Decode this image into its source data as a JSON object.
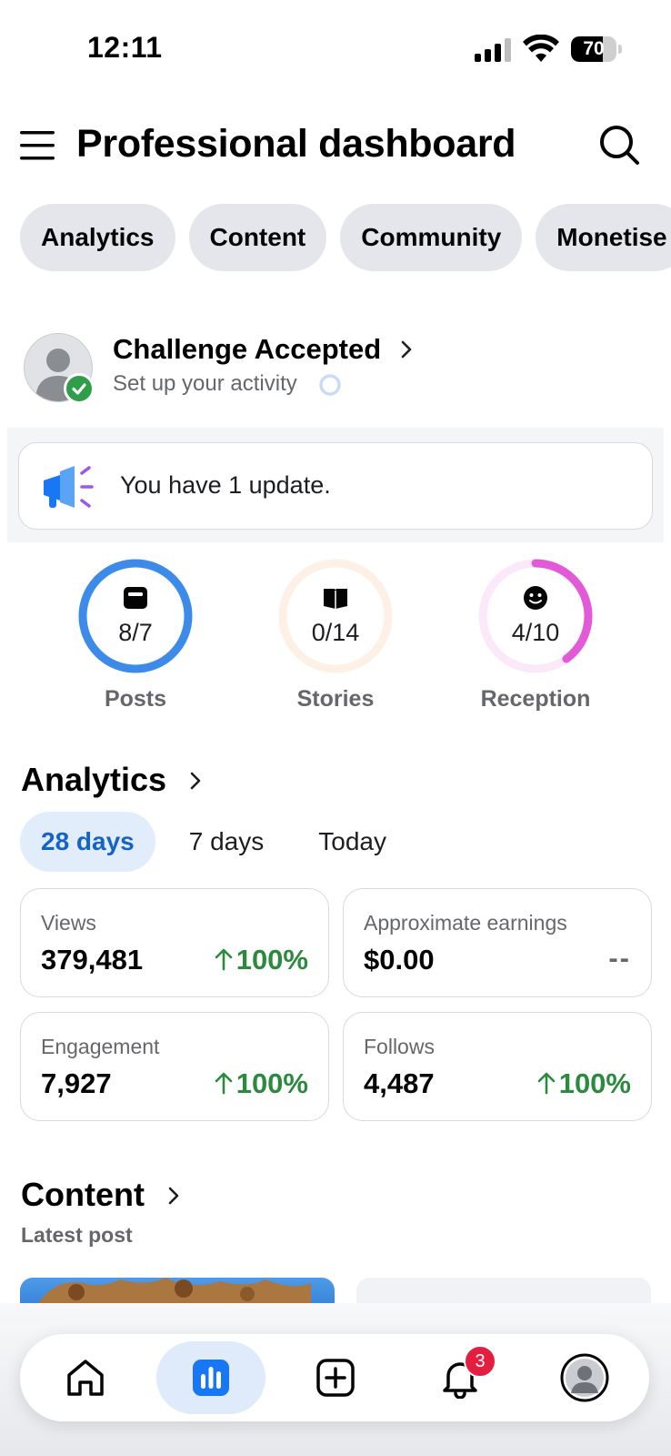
{
  "status_bar": {
    "time": "12:11",
    "battery": "70",
    "battery_level": 0.7
  },
  "header": {
    "title": "Professional dashboard"
  },
  "tabs": [
    {
      "label": "Analytics"
    },
    {
      "label": "Content"
    },
    {
      "label": "Community"
    },
    {
      "label": "Monetise"
    }
  ],
  "challenge": {
    "title": "Challenge Accepted",
    "subtitle": "Set up your activity"
  },
  "update": {
    "text": "You have 1 update."
  },
  "rings": [
    {
      "label": "Posts",
      "value": "8/7",
      "icon": "post-icon",
      "color": "#3d8be8",
      "track": "#dbe8fb",
      "progress": 1.0
    },
    {
      "label": "Stories",
      "value": "0/14",
      "icon": "book-icon",
      "color": "#f6a85e",
      "track": "#fdf0e4",
      "progress": 0.0
    },
    {
      "label": "Reception",
      "value": "4/10",
      "icon": "smiley-icon",
      "color": "#e25ad8",
      "track": "#fbe8f9",
      "progress": 0.4
    }
  ],
  "analytics": {
    "title": "Analytics",
    "ranges": [
      {
        "label": "28 days",
        "active": true
      },
      {
        "label": "7 days"
      },
      {
        "label": "Today"
      }
    ],
    "metrics": [
      {
        "label": "Views",
        "value": "379,481",
        "change": "100%"
      },
      {
        "label": "Approximate earnings",
        "value": "$0.00",
        "change": "--"
      },
      {
        "label": "Engagement",
        "value": "7,927",
        "change": "100%"
      },
      {
        "label": "Follows",
        "value": "4,487",
        "change": "100%"
      }
    ]
  },
  "content": {
    "title": "Content",
    "subtitle": "Latest post"
  },
  "bottom_nav": {
    "items": [
      "home-icon",
      "dashboard-icon",
      "create-icon",
      "notifications-icon",
      "profile-icon"
    ],
    "notification_count": "3"
  },
  "colors": {
    "accent": "#1463c9",
    "positive": "#2c8a3f",
    "badge": "#e41e3f"
  }
}
